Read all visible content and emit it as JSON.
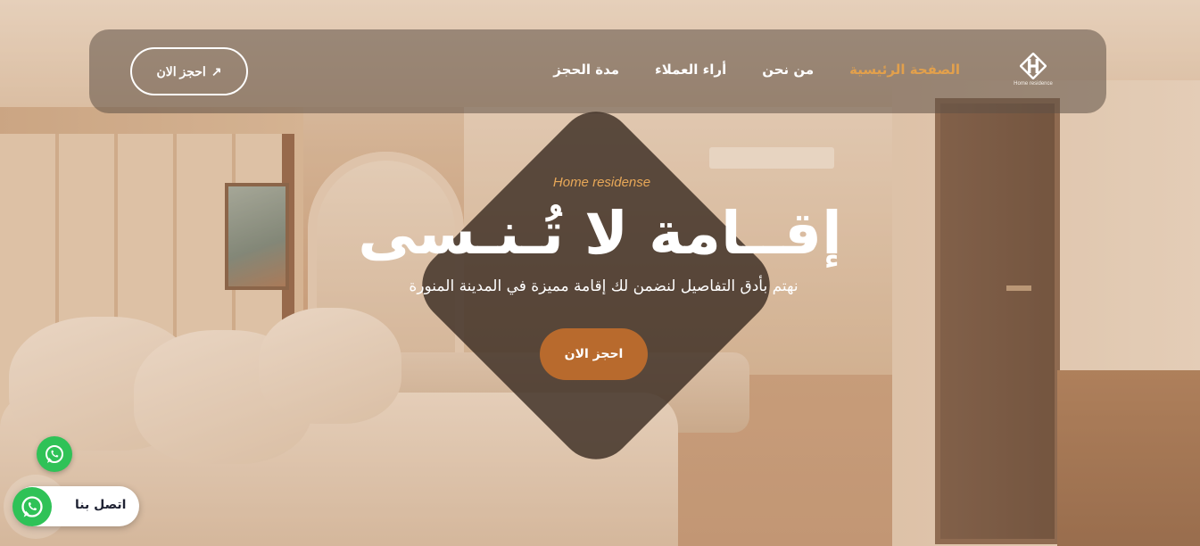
{
  "header": {
    "logo": {
      "text": "Home residence",
      "icon": "home-residence-logo-icon"
    },
    "nav": [
      {
        "label": "الصفحة الرئيسية",
        "active": true
      },
      {
        "label": "من نحن",
        "active": false
      },
      {
        "label": "أراء العملاء",
        "active": false
      },
      {
        "label": "مدة الحجز",
        "active": false
      }
    ],
    "book_button": {
      "label": "احجز الان",
      "icon": "arrow-up-right-icon",
      "icon_glyph": "↗"
    }
  },
  "hero": {
    "brand": "Home residense",
    "title": "إقــامة لا تُـنـسى",
    "subtitle": "نهتم بأدق التفاصيل لنضمن لك إقامة مميزة في المدينة المنورة",
    "cta_label": "احجز الان"
  },
  "whatsapp": {
    "small_icon": "whatsapp-icon",
    "pill_label": "اتصل بنا",
    "pill_icon": "whatsapp-icon"
  },
  "colors": {
    "accent": "#e2a04c",
    "cta": "#b86a2d",
    "whatsapp": "#2fc257",
    "header_bg": "rgba(95,80,70,.55)"
  }
}
